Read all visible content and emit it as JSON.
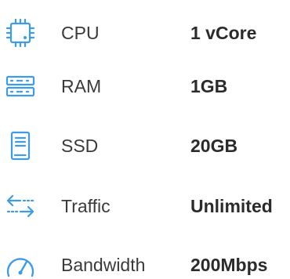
{
  "accent_color": "#3d9be9",
  "specs": [
    {
      "icon": "cpu-icon",
      "label": "CPU",
      "value": "1 vCore"
    },
    {
      "icon": "ram-icon",
      "label": "RAM",
      "value": "1GB"
    },
    {
      "icon": "ssd-icon",
      "label": "SSD",
      "value": "20GB"
    },
    {
      "icon": "traffic-icon",
      "label": "Traffic",
      "value": "Unlimited"
    },
    {
      "icon": "bandwidth-icon",
      "label": "Bandwidth",
      "value": "200Mbps"
    }
  ]
}
